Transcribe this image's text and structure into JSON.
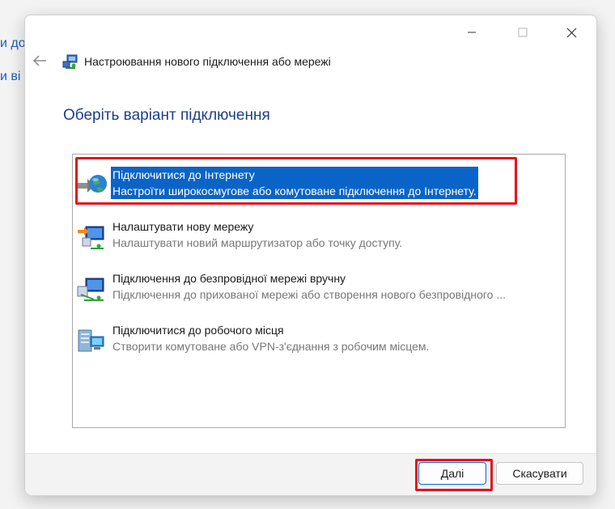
{
  "background": {
    "fragments": [
      "и до",
      "и ві"
    ]
  },
  "window": {
    "controls": {
      "minimize": "minimize-icon",
      "maximize": "maximize-icon",
      "close": "close-icon"
    },
    "title": "Настроювання нового підключення або мережі"
  },
  "heading": "Оберіть варіант підключення",
  "options": [
    {
      "title": "Підключитися до Інтернету",
      "description": "Настроїти широкосмугове або комутоване підключення до Інтернету.",
      "icon": "internet-globe-icon",
      "selected": true
    },
    {
      "title": "Налаштувати нову мережу",
      "description": "Налаштувати новий маршрутизатор або точку доступу.",
      "icon": "new-network-icon",
      "selected": false
    },
    {
      "title": "Підключення до безпровідної мережі вручну",
      "description": "Підключення до прихованої мережі або створення нового безпровідного ...",
      "icon": "wireless-network-icon",
      "selected": false
    },
    {
      "title": "Підключитися до робочого місця",
      "description": "Створити комутоване або VPN-з'єднання з робочим місцем.",
      "icon": "workplace-icon",
      "selected": false
    }
  ],
  "buttons": {
    "next": "Далі",
    "cancel": "Скасувати"
  },
  "colors": {
    "selection": "#0a64c8",
    "heading": "#1e3f87",
    "highlight_outline": "#e8101a"
  }
}
